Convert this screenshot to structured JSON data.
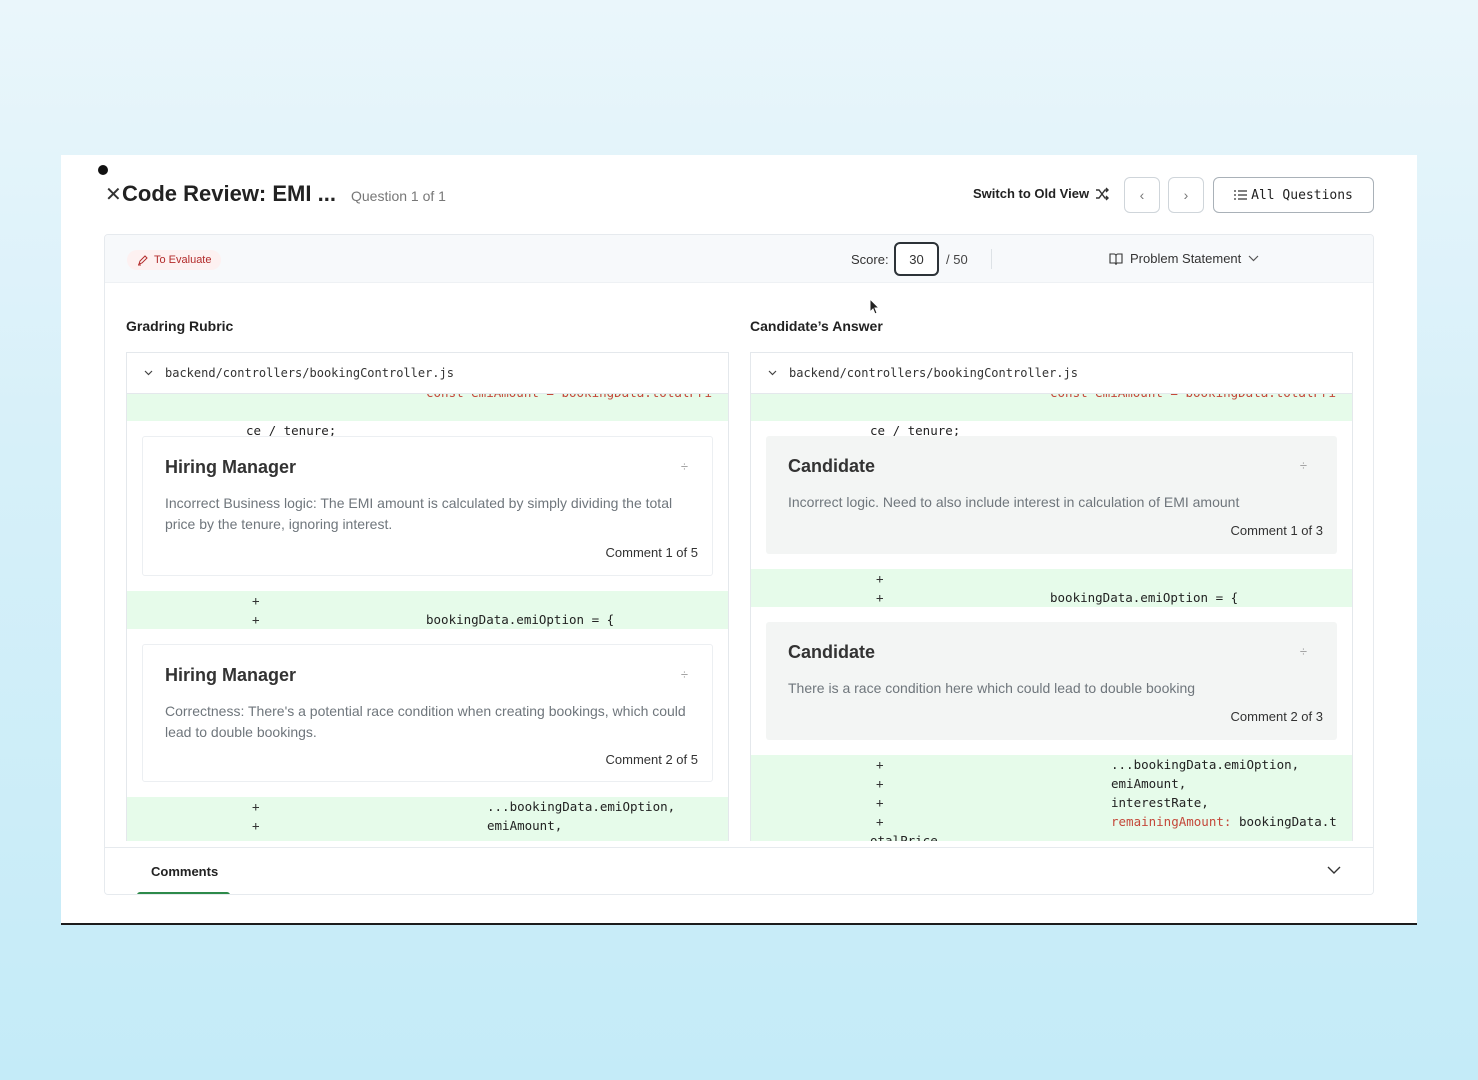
{
  "header": {
    "title": "Code Review: EMI ...",
    "question_count": "Question 1 of 1",
    "switch_view": "Switch to Old View",
    "all_questions": "All Questions"
  },
  "status": {
    "badge": "To Evaluate",
    "score_label": "Score:",
    "score_value": "30",
    "score_max": "/ 50",
    "problem_statement": "Problem Statement"
  },
  "rubric": {
    "title": "Gradring Rubric",
    "file": "backend/controllers/bookingController.js",
    "top_line_cut": "const emiAmount = bookingData.totalPri",
    "top_line": "ce / tenure;",
    "comments": [
      {
        "author": "Hiring Manager",
        "text": "Incorrect Business logic: The EMI amount is calculated by simply dividing the total price by the tenure, ignoring interest.",
        "count": "Comment 1 of 5"
      },
      {
        "author": "Hiring Manager",
        "text": "Correctness: There's a potential race condition when creating bookings, which could lead to double bookings.",
        "count": "Comment 2 of 5"
      }
    ],
    "mid_lines": [
      {
        "plus": "+",
        "code": ""
      },
      {
        "plus": "+",
        "code": "bookingData.emiOption = {"
      }
    ],
    "bottom_lines": [
      {
        "plus": "+",
        "code": "...bookingData.emiOption,"
      },
      {
        "plus": "+",
        "code": "emiAmount,"
      }
    ]
  },
  "answer": {
    "title": "Candidate’s Answer",
    "file": "backend/controllers/bookingController.js",
    "top_line_cut": "const emiAmount = bookingData.totalPri",
    "top_line": "ce / tenure;",
    "comments": [
      {
        "author": "Candidate",
        "text": "Incorrect logic. Need to also include interest in calculation of EMI amount",
        "count": "Comment 1 of 3"
      },
      {
        "author": "Candidate",
        "text": "There is a race condition here which could lead to double booking",
        "count": "Comment 2 of 3"
      }
    ],
    "mid_lines": [
      {
        "plus": "+",
        "code": ""
      },
      {
        "plus": "+",
        "code": "bookingData.emiOption = {"
      }
    ],
    "bottom_lines": [
      {
        "plus": "+",
        "code": "...bookingData.emiOption,"
      },
      {
        "plus": "+",
        "code": "emiAmount,"
      },
      {
        "plus": "+",
        "code": "interestRate,"
      },
      {
        "plus": "+",
        "key": "remainingAmount:",
        "code": " bookingData.t"
      },
      {
        "plus": "",
        "code": "otalPrice"
      }
    ]
  },
  "footer": {
    "tab": "Comments"
  },
  "colors": {
    "accent_green": "#2d8a4a",
    "diff_bg": "#e6fbea",
    "badge_red": "#b22a2a"
  }
}
